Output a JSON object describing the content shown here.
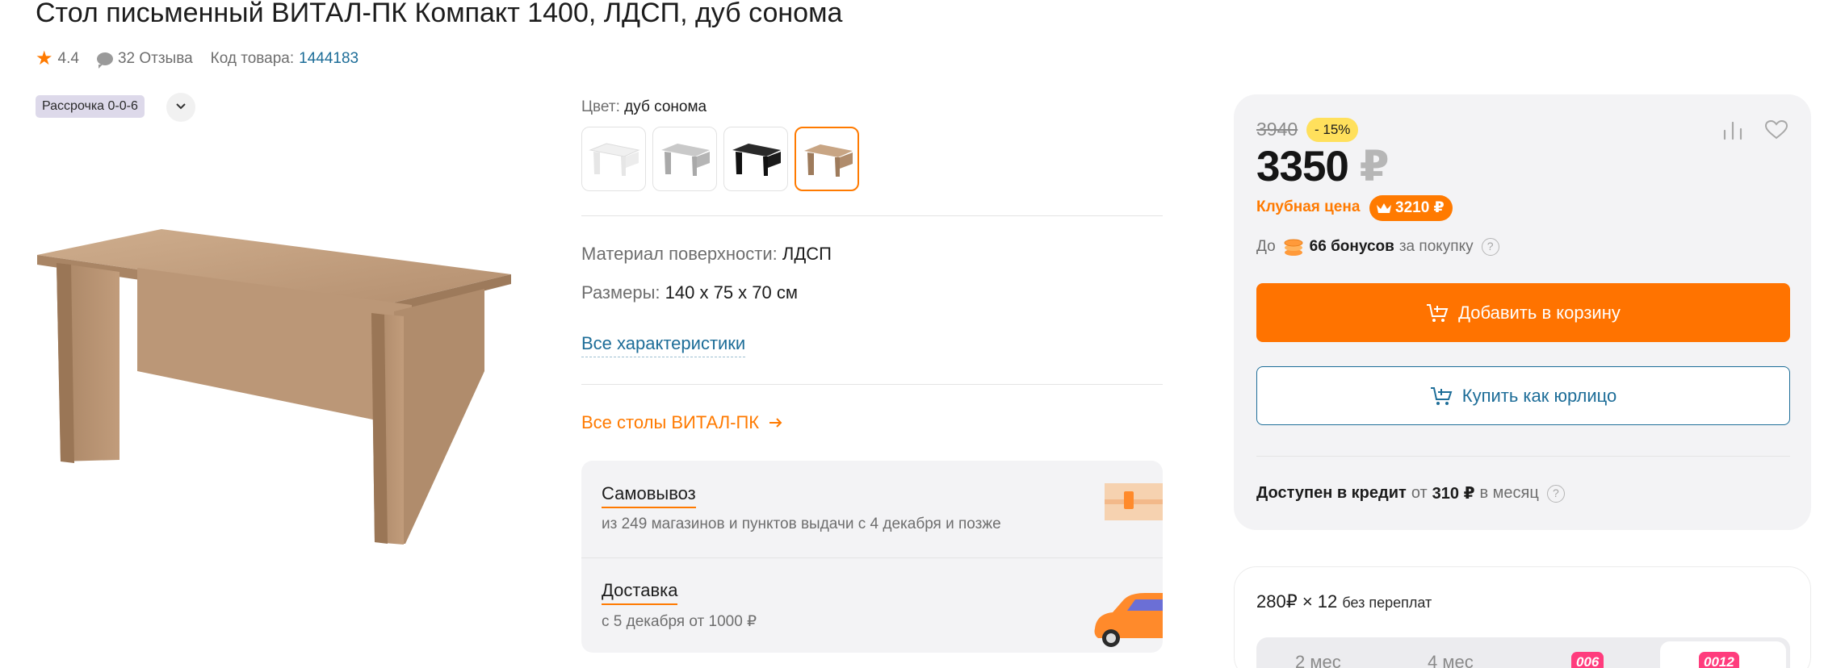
{
  "product": {
    "title": "Стол письменный ВИТАЛ-ПК Компакт 1400, ЛДСП, дуб сонома",
    "rating": "4.4",
    "reviews": "32 Отзыва",
    "code_label": "Код товара:",
    "code": "1444183",
    "installment_badge": "Рассрочка 0-0-6"
  },
  "color": {
    "label": "Цвет:",
    "value": "дуб сонома",
    "swatches": [
      {
        "name": "white",
        "hex": "#f2f2f2"
      },
      {
        "name": "grey",
        "hex": "#b8b8b8"
      },
      {
        "name": "black",
        "hex": "#1e1e1e"
      },
      {
        "name": "sonoma-oak",
        "hex": "#b48b69",
        "selected": true
      }
    ]
  },
  "specs": {
    "material_label": "Материал поверхности:",
    "material_value": "ЛДСП",
    "size_label": "Размеры:",
    "size_value": "140 x 75 x 70 см",
    "all_specs_link": "Все характеристики",
    "all_tables_link": "Все столы ВИТАЛ-ПК"
  },
  "delivery": {
    "pickup_title": "Самовывоз",
    "pickup_sub": "из 249 магазинов и пунктов выдачи с 4 декабря и позже",
    "courier_title": "Доставка",
    "courier_sub": "с 5 декабря от 1000 ₽"
  },
  "price": {
    "old": "3940",
    "discount": "- 15%",
    "current": "3350",
    "currency": "₽",
    "club_label": "Клубная цена",
    "club_price": "3210 ₽",
    "bonus_prefix": "До",
    "bonus_value": "66 бонусов",
    "bonus_suffix": "за покупку",
    "add_to_cart": "Добавить в корзину",
    "buy_legal": "Купить как юрлицо",
    "credit_label": "Доступен в кредит",
    "credit_from": "от",
    "credit_value": "310 ₽",
    "credit_suffix": "в месяц"
  },
  "installment_plan": {
    "summary": "280₽ × 12",
    "summary_note": "без переплат",
    "tabs": [
      "2 мес",
      "4 мес",
      "006",
      "0012"
    ],
    "active_tab": "0012"
  },
  "colors": {
    "accent": "#ff7300",
    "link": "#1d6d98",
    "discount_bg": "#ffe05c",
    "panel_bg": "#f3f3f5"
  },
  "icons": [
    "star-icon",
    "comment-icon",
    "chevron-down-icon",
    "arrow-right-icon",
    "compare-icon",
    "heart-icon",
    "crown-icon",
    "coins-icon",
    "help-icon",
    "cart-plus-icon"
  ]
}
